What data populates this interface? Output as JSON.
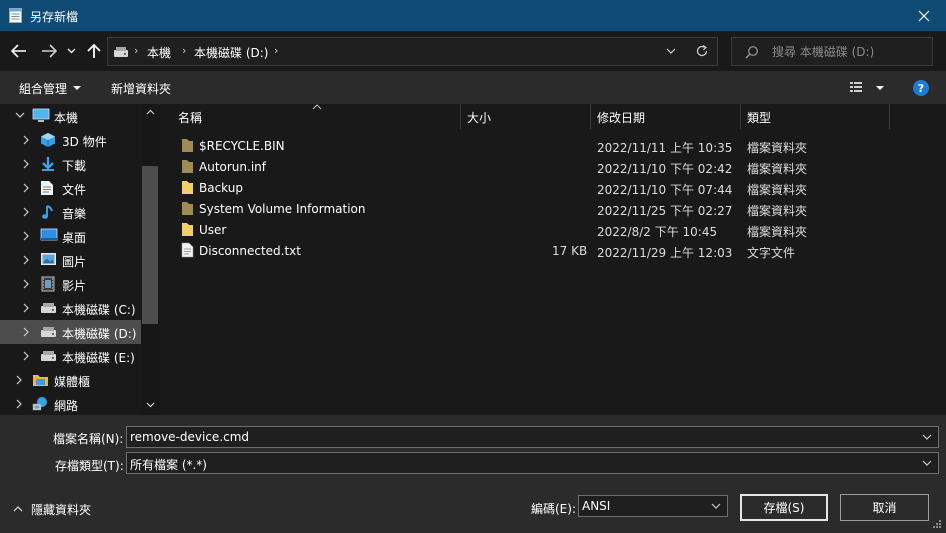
{
  "window": {
    "title": "另存新檔",
    "close_glyph": "✕"
  },
  "nav": {
    "breadcrumbs": [
      "本機",
      "本機磁碟 (D:)"
    ],
    "search_placeholder": "搜尋 本機磁碟 (D:)"
  },
  "toolbar": {
    "organize_label": "組合管理",
    "new_folder_label": "新增資料夾",
    "help_label": "?"
  },
  "sidebar": {
    "items": [
      {
        "label": "本機",
        "icon": "pc-icon"
      },
      {
        "label": "3D 物件",
        "icon": "3d-objects-icon"
      },
      {
        "label": "下載",
        "icon": "download-icon"
      },
      {
        "label": "文件",
        "icon": "document-icon"
      },
      {
        "label": "音樂",
        "icon": "music-icon"
      },
      {
        "label": "桌面",
        "icon": "desktop-icon"
      },
      {
        "label": "圖片",
        "icon": "pictures-icon"
      },
      {
        "label": "影片",
        "icon": "video-icon"
      },
      {
        "label": "本機磁碟 (C:)",
        "icon": "drive-icon"
      },
      {
        "label": "本機磁碟 (D:)",
        "icon": "drive-icon",
        "selected": true
      },
      {
        "label": "本機磁碟 (E:)",
        "icon": "drive-icon"
      },
      {
        "label": "媒體櫃",
        "icon": "library-icon"
      },
      {
        "label": "網路",
        "icon": "network-icon"
      }
    ]
  },
  "columns": {
    "name": "名稱",
    "size": "大小",
    "modified": "修改日期",
    "type": "類型"
  },
  "files": [
    {
      "name": "$RECYCLE.BIN",
      "size": "",
      "modified": "2022/11/11 上午 10:35",
      "type": "檔案資料夾",
      "kind": "folder-dim"
    },
    {
      "name": "Autorun.inf",
      "size": "",
      "modified": "2022/11/10 下午 02:42",
      "type": "檔案資料夾",
      "kind": "folder-dim"
    },
    {
      "name": "Backup",
      "size": "",
      "modified": "2022/11/10 下午 07:44",
      "type": "檔案資料夾",
      "kind": "folder"
    },
    {
      "name": "System Volume Information",
      "size": "",
      "modified": "2022/11/25 下午 02:27",
      "type": "檔案資料夾",
      "kind": "folder-dim"
    },
    {
      "name": "User",
      "size": "",
      "modified": "2022/8/2 下午 10:45",
      "type": "檔案資料夾",
      "kind": "folder"
    },
    {
      "name": "Disconnected.txt",
      "size": "17 KB",
      "modified": "2022/11/29 上午 12:03",
      "type": "文字文件",
      "kind": "text-file"
    }
  ],
  "footer": {
    "filename_label": "檔案名稱(N):",
    "filename_value": "remove-device.cmd",
    "filetype_label": "存檔類型(T):",
    "filetype_value": "所有檔案  (*.*)",
    "encoding_label": "編碼(E):",
    "encoding_value": "ANSI",
    "save_label": "存檔(S)",
    "cancel_label": "取消",
    "hide_folders_label": "隱藏資料夾"
  },
  "colors": {
    "titlebar": "#0f4b74",
    "background": "#191919",
    "panel": "#2b2b2b",
    "selection": "#4d4d4d",
    "folder": "#f3cf6b",
    "folder_dim": "#a08a55"
  }
}
